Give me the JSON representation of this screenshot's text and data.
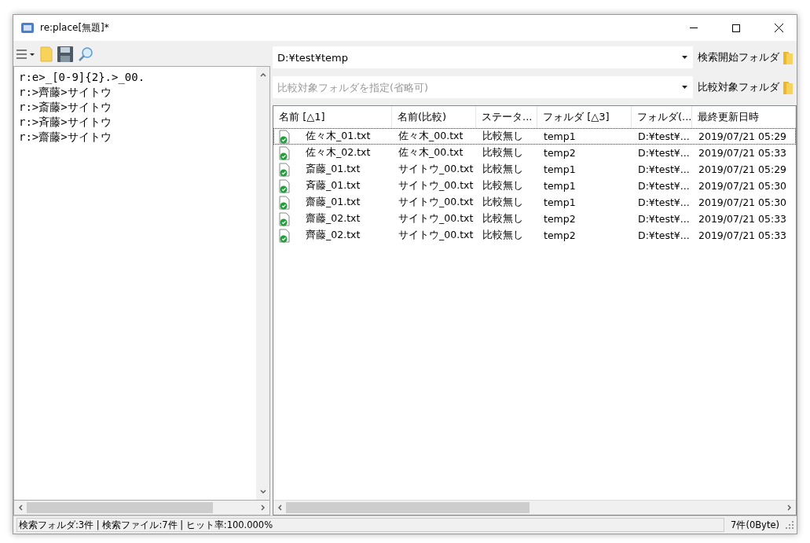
{
  "window": {
    "title": "re:place[無題]*"
  },
  "editor": {
    "lines": [
      "r:e>_[0-9]{2}.>_00.",
      "r:>齊藤>サイトウ",
      "r:>斎藤>サイトウ",
      "r:>斉藤>サイトウ",
      "r:>齋藤>サイトウ"
    ]
  },
  "search_folder": {
    "value": "D:¥test¥temp",
    "button": "検索開始フォルダ"
  },
  "compare_folder": {
    "placeholder": "比較対象フォルダを指定(省略可)",
    "button": "比較対象フォルダ"
  },
  "table": {
    "columns": [
      "名前 [△1]",
      "名前(比較)",
      "ステータ...",
      "フォルダ [△3]",
      "フォルダ(...",
      "最終更新日時"
    ],
    "rows": [
      {
        "selected": true,
        "cells": [
          "佐々木_01.txt",
          "佐々木_00.txt",
          "比較無し",
          "temp1",
          "D:¥test¥...",
          "2019/07/21 05:29"
        ]
      },
      {
        "selected": false,
        "cells": [
          "佐々木_02.txt",
          "佐々木_00.txt",
          "比較無し",
          "temp2",
          "D:¥test¥...",
          "2019/07/21 05:33"
        ]
      },
      {
        "selected": false,
        "cells": [
          "斎藤_01.txt",
          "サイトウ_00.txt",
          "比較無し",
          "temp1",
          "D:¥test¥...",
          "2019/07/21 05:29"
        ]
      },
      {
        "selected": false,
        "cells": [
          "斉藤_01.txt",
          "サイトウ_00.txt",
          "比較無し",
          "temp1",
          "D:¥test¥...",
          "2019/07/21 05:30"
        ]
      },
      {
        "selected": false,
        "cells": [
          "齋藤_01.txt",
          "サイトウ_00.txt",
          "比較無し",
          "temp1",
          "D:¥test¥...",
          "2019/07/21 05:30"
        ]
      },
      {
        "selected": false,
        "cells": [
          "齋藤_02.txt",
          "サイトウ_00.txt",
          "比較無し",
          "temp2",
          "D:¥test¥...",
          "2019/07/21 05:33"
        ]
      },
      {
        "selected": false,
        "cells": [
          "齊藤_02.txt",
          "サイトウ_00.txt",
          "比較無し",
          "temp2",
          "D:¥test¥...",
          "2019/07/21 05:33"
        ]
      }
    ]
  },
  "status_bar": {
    "left": "検索フォルダ:3件 | 検索ファイル:7件 | ヒット率:100.000%",
    "right": "7件(0Byte)"
  }
}
